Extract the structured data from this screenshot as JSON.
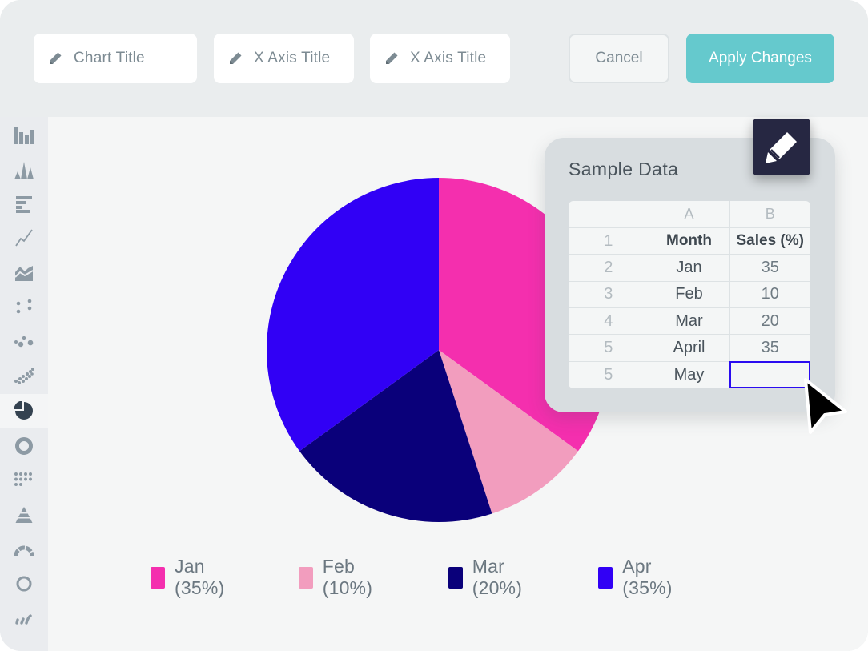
{
  "toolbar": {
    "fields": [
      {
        "label": "Chart Title",
        "icon": "pencil-icon"
      },
      {
        "label": "X Axis Title",
        "icon": "pencil-icon"
      },
      {
        "label": "X Axis Title",
        "icon": "pencil-icon"
      }
    ],
    "cancel_label": "Cancel",
    "apply_label": "Apply Changes",
    "apply_color": "#65c9cd"
  },
  "sidebar": {
    "items": [
      {
        "name": "bar-chart",
        "icon": "bar-chart-icon",
        "active": false
      },
      {
        "name": "spike-chart",
        "icon": "spike-chart-icon",
        "active": false
      },
      {
        "name": "horizontal-bar-chart",
        "icon": "horizontal-bar-chart-icon",
        "active": false
      },
      {
        "name": "line-chart",
        "icon": "line-chart-icon",
        "active": false
      },
      {
        "name": "area-chart",
        "icon": "area-chart-icon",
        "active": false
      },
      {
        "name": "scatter-chart",
        "icon": "scatter-chart-icon",
        "active": false
      },
      {
        "name": "bubble-chart",
        "icon": "bubble-chart-icon",
        "active": false
      },
      {
        "name": "dense-scatter-chart",
        "icon": "dense-scatter-chart-icon",
        "active": false
      },
      {
        "name": "pie-chart",
        "icon": "pie-chart-icon",
        "active": true
      },
      {
        "name": "donut-chart",
        "icon": "donut-chart-icon",
        "active": false
      },
      {
        "name": "dot-matrix-chart",
        "icon": "dot-matrix-chart-icon",
        "active": false
      },
      {
        "name": "pyramid-chart",
        "icon": "pyramid-chart-icon",
        "active": false
      },
      {
        "name": "gauge-chart",
        "icon": "gauge-chart-icon",
        "active": false
      },
      {
        "name": "ring-chart",
        "icon": "ring-chart-icon",
        "active": false
      },
      {
        "name": "sparkline-chart",
        "icon": "sparkline-chart-icon",
        "active": false
      }
    ]
  },
  "data_panel": {
    "title": "Sample Data",
    "edit_icon": "pencil-icon",
    "column_headers": [
      "",
      "A",
      "B"
    ],
    "rows": [
      {
        "row": "1",
        "a": "Month",
        "b": "Sales (%)",
        "header": true
      },
      {
        "row": "2",
        "a": "Jan",
        "b": "35"
      },
      {
        "row": "3",
        "a": "Feb",
        "b": "10"
      },
      {
        "row": "4",
        "a": "Mar",
        "b": "20"
      },
      {
        "row": "5",
        "a": "April",
        "b": "35"
      },
      {
        "row": "5",
        "a": "May",
        "b": "",
        "selected_b": true
      }
    ],
    "selection_color": "#2a0cf0"
  },
  "chart_data": {
    "type": "pie",
    "title": "",
    "start": "top",
    "direction": "clockwise",
    "categories": [
      "Jan",
      "Feb",
      "Mar",
      "Apr"
    ],
    "values": [
      35,
      10,
      20,
      35
    ],
    "unit": "%",
    "colors": [
      "#f42fae",
      "#f29dbe",
      "#0a007a",
      "#3100f5"
    ],
    "legend": {
      "position": "bottom",
      "entries": [
        "Jan (35%)",
        "Feb (10%)",
        "Mar (20%)",
        "Apr (35%)"
      ]
    }
  }
}
